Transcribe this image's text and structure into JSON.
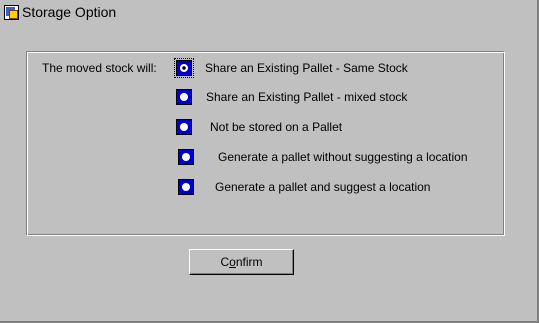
{
  "window": {
    "title": "Storage Option",
    "icon": "app-window-icon"
  },
  "form": {
    "prompt": "The moved stock will:",
    "options": [
      {
        "label": "Share an Existing Pallet - Same Stock",
        "selected": true
      },
      {
        "label": "Share an Existing Pallet - mixed stock",
        "selected": false
      },
      {
        "label": "Not be stored on a Pallet",
        "selected": false
      },
      {
        "label": "Generate a pallet without suggesting a location",
        "selected": false
      },
      {
        "label": "Generate a pallet and suggest a location",
        "selected": false
      }
    ]
  },
  "buttons": {
    "confirm_prefix": "C",
    "confirm_mnemonic": "o",
    "confirm_suffix": "nfirm"
  },
  "colors": {
    "background": "#c0c0c0",
    "radio_fill": "#0000cc"
  }
}
